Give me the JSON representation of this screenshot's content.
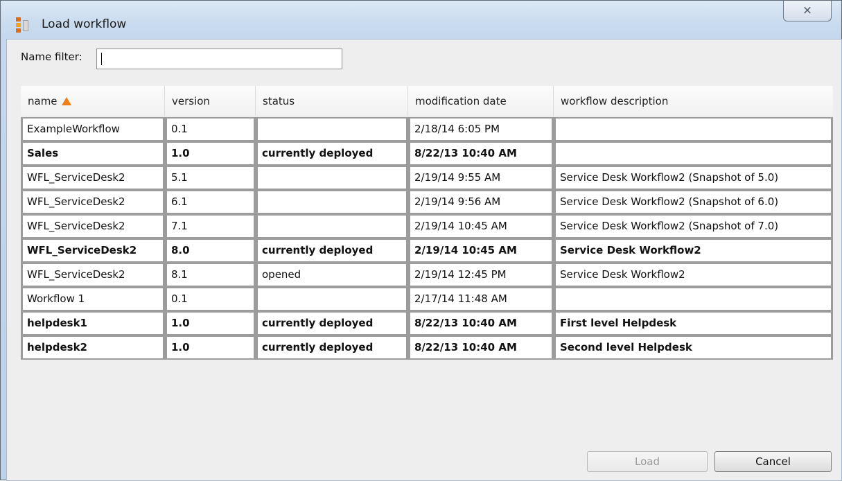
{
  "window": {
    "title": "Load workflow",
    "close_label": "⨯"
  },
  "filter": {
    "label": "Name filter:",
    "value": ""
  },
  "table": {
    "headers": [
      "name",
      "version",
      "status",
      "modification date",
      "workflow description"
    ],
    "rows": [
      {
        "name": "ExampleWorkflow",
        "version": "0.1",
        "status": "",
        "date": "2/18/14 6:05 PM",
        "description": "",
        "bold": false
      },
      {
        "name": "Sales",
        "version": "1.0",
        "status": "currently deployed",
        "date": "8/22/13 10:40 AM",
        "description": "",
        "bold": true
      },
      {
        "name": "WFL_ServiceDesk2",
        "version": "5.1",
        "status": "",
        "date": "2/19/14 9:55 AM",
        "description": "Service Desk Workflow2 (Snapshot of 5.0)",
        "bold": false
      },
      {
        "name": "WFL_ServiceDesk2",
        "version": "6.1",
        "status": "",
        "date": "2/19/14 9:56 AM",
        "description": "Service Desk Workflow2 (Snapshot of 6.0)",
        "bold": false
      },
      {
        "name": "WFL_ServiceDesk2",
        "version": "7.1",
        "status": "",
        "date": "2/19/14 10:45 AM",
        "description": "Service Desk Workflow2 (Snapshot of 7.0)",
        "bold": false
      },
      {
        "name": "WFL_ServiceDesk2",
        "version": "8.0",
        "status": "currently deployed",
        "date": "2/19/14 10:45 AM",
        "description": "Service Desk Workflow2",
        "bold": true
      },
      {
        "name": "WFL_ServiceDesk2",
        "version": "8.1",
        "status": "opened",
        "date": "2/19/14 12:45 PM",
        "description": "Service Desk Workflow2",
        "bold": false
      },
      {
        "name": "Workflow 1",
        "version": "0.1",
        "status": "",
        "date": "2/17/14 11:48 AM",
        "description": "",
        "bold": false
      },
      {
        "name": "helpdesk1",
        "version": "1.0",
        "status": "currently deployed",
        "date": "8/22/13 10:40 AM",
        "description": "First level Helpdesk",
        "bold": true
      },
      {
        "name": "helpdesk2",
        "version": "1.0",
        "status": "currently deployed",
        "date": "8/22/13 10:40 AM",
        "description": "Second level Helpdesk",
        "bold": true
      }
    ]
  },
  "buttons": {
    "load": "Load",
    "cancel": "Cancel"
  }
}
